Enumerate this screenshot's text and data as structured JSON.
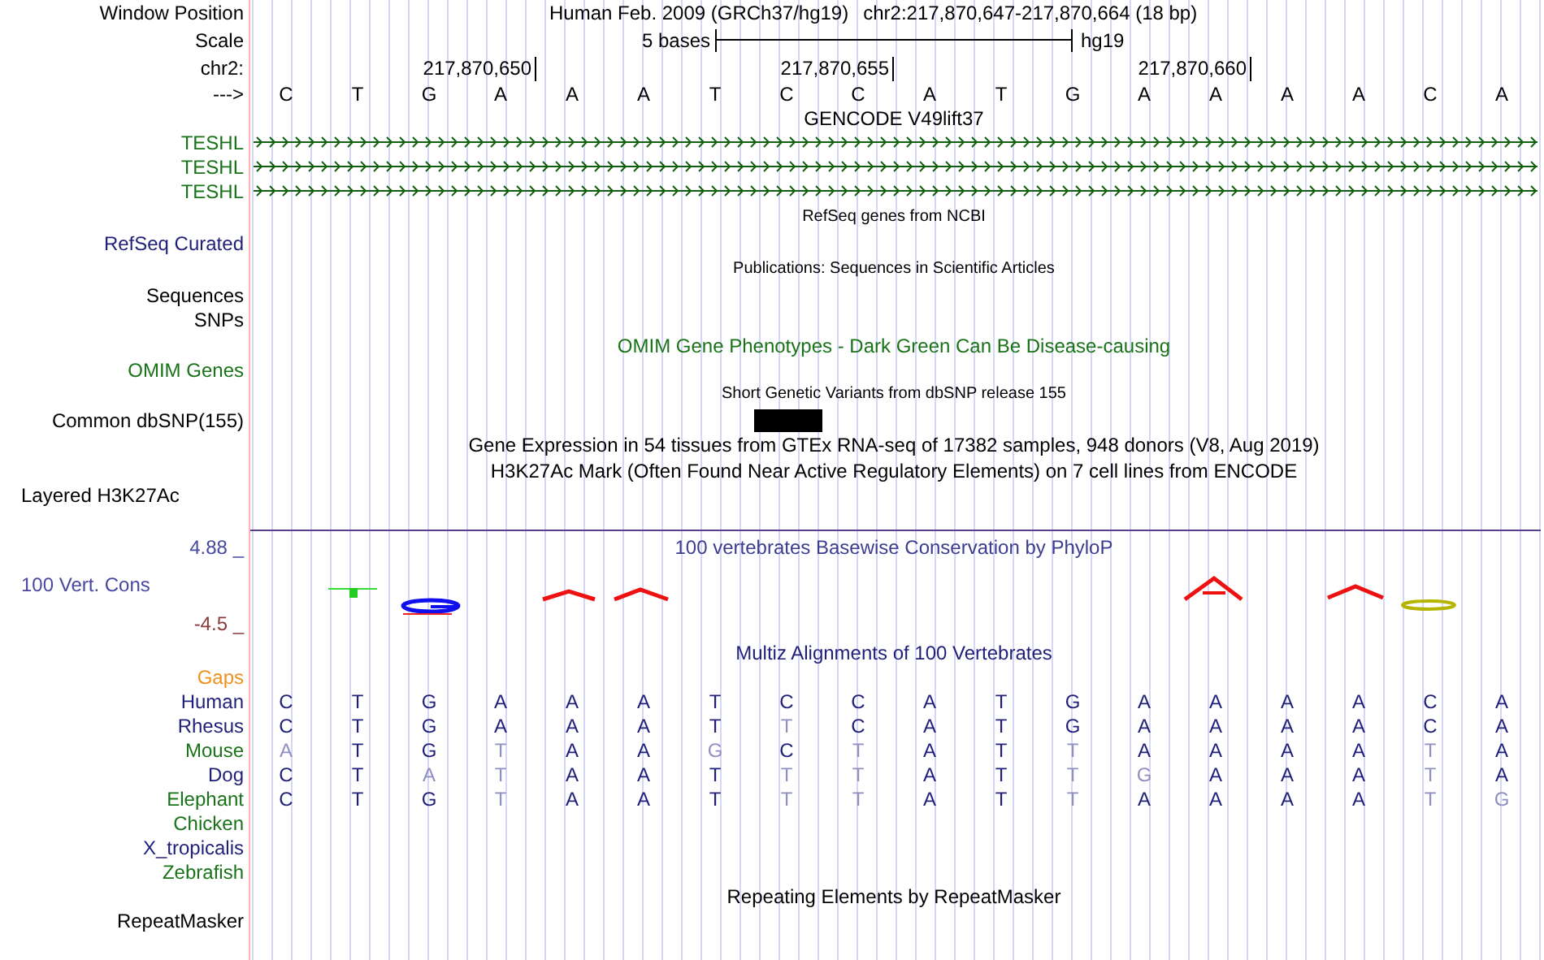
{
  "position": {
    "label": "Window Position",
    "assembly": "Human Feb. 2009 (GRCh37/hg19)",
    "range": "chr2:217,870,647-217,870,664 (18 bp)"
  },
  "scale": {
    "label": "Scale",
    "length": "5 bases",
    "assembly": "hg19"
  },
  "ruler": {
    "label": "chr2:",
    "ticks": [
      "217,870,650",
      "217,870,655",
      "217,870,660"
    ]
  },
  "bases": {
    "label": "--->",
    "letters": [
      "C",
      "T",
      "G",
      "A",
      "A",
      "A",
      "T",
      "C",
      "C",
      "A",
      "T",
      "G",
      "A",
      "A",
      "A",
      "A",
      "C",
      "A"
    ]
  },
  "tracks": [
    {
      "kind": "gene_track",
      "title": "GENCODE V49lift37",
      "rows": [
        {
          "label": "TESHL",
          "color": "#197319"
        },
        {
          "label": "TESHL",
          "color": "#197319"
        },
        {
          "label": "TESHL",
          "color": "#197319"
        }
      ]
    },
    {
      "kind": "annotation_track",
      "title": "RefSeq genes from NCBI",
      "rows": [
        {
          "label": "RefSeq Curated",
          "color": "#1f1f7a"
        }
      ]
    },
    {
      "kind": "annotation_track",
      "title": "Publications: Sequences in Scientific Articles",
      "rows": [
        {
          "label": "Sequences",
          "color": "#000000"
        },
        {
          "label": "SNPs",
          "color": "#000000"
        }
      ]
    },
    {
      "kind": "phenotype_track",
      "title": "OMIM Gene Phenotypes - Dark Green Can Be Disease-causing",
      "rows": [
        {
          "label": "OMIM Genes",
          "color": "#197319"
        }
      ]
    },
    {
      "kind": "variant_track",
      "title": "Short Genetic Variants from dbSNP release 155",
      "rows": [
        {
          "label": "Common dbSNP(155)",
          "color": "#000000"
        }
      ]
    },
    {
      "kind": "expression_track",
      "title": "Gene Expression in 54 tissues from GTEx RNA-seq of 17382 samples, 948 donors (V8, Aug 2019)"
    },
    {
      "kind": "signal_track",
      "title": "H3K27Ac Mark (Often Found Near Active Regulatory Elements) on 7 cell lines from ENCODE",
      "rows": [
        {
          "label": "Layered H3K27Ac",
          "color": "#000000"
        }
      ]
    },
    {
      "kind": "conservation_track",
      "title": "100 vertebrates Basewise Conservation by PhyloP",
      "label": "100 Vert. Cons",
      "axis_max": "4.88 _",
      "axis_min": "-4.5 _"
    },
    {
      "kind": "alignment_track",
      "title": "Multiz Alignments of 100 Vertebrates",
      "gaps": {
        "label": "Gaps",
        "color": "#f0901e"
      },
      "species": [
        {
          "label": "Human",
          "color": "#1f1f7a",
          "bases": [
            {
              "base": "C",
              "match": true
            },
            {
              "base": "T",
              "match": true
            },
            {
              "base": "G",
              "match": true
            },
            {
              "base": "A",
              "match": true
            },
            {
              "base": "A",
              "match": true
            },
            {
              "base": "A",
              "match": true
            },
            {
              "base": "T",
              "match": true
            },
            {
              "base": "C",
              "match": true
            },
            {
              "base": "C",
              "match": true
            },
            {
              "base": "A",
              "match": true
            },
            {
              "base": "T",
              "match": true
            },
            {
              "base": "G",
              "match": true
            },
            {
              "base": "A",
              "match": true
            },
            {
              "base": "A",
              "match": true
            },
            {
              "base": "A",
              "match": true
            },
            {
              "base": "A",
              "match": true
            },
            {
              "base": "C",
              "match": true
            },
            {
              "base": "A",
              "match": true
            }
          ]
        },
        {
          "label": "Rhesus",
          "color": "#1f1f7a",
          "bases": [
            {
              "base": "C",
              "match": true
            },
            {
              "base": "T",
              "match": true
            },
            {
              "base": "G",
              "match": true
            },
            {
              "base": "A",
              "match": true
            },
            {
              "base": "A",
              "match": true
            },
            {
              "base": "A",
              "match": true
            },
            {
              "base": "T",
              "match": true
            },
            {
              "base": "T",
              "match": false
            },
            {
              "base": "C",
              "match": true
            },
            {
              "base": "A",
              "match": true
            },
            {
              "base": "T",
              "match": true
            },
            {
              "base": "G",
              "match": true
            },
            {
              "base": "A",
              "match": true
            },
            {
              "base": "A",
              "match": true
            },
            {
              "base": "A",
              "match": true
            },
            {
              "base": "A",
              "match": true
            },
            {
              "base": "C",
              "match": true
            },
            {
              "base": "A",
              "match": true
            }
          ]
        },
        {
          "label": "Mouse",
          "color": "#197319",
          "bases": [
            {
              "base": "A",
              "match": false
            },
            {
              "base": "T",
              "match": true
            },
            {
              "base": "G",
              "match": true
            },
            {
              "base": "T",
              "match": false
            },
            {
              "base": "A",
              "match": true
            },
            {
              "base": "A",
              "match": true
            },
            {
              "base": "G",
              "match": false
            },
            {
              "base": "C",
              "match": true
            },
            {
              "base": "T",
              "match": false
            },
            {
              "base": "A",
              "match": true
            },
            {
              "base": "T",
              "match": true
            },
            {
              "base": "T",
              "match": false
            },
            {
              "base": "A",
              "match": true
            },
            {
              "base": "A",
              "match": true
            },
            {
              "base": "A",
              "match": true
            },
            {
              "base": "A",
              "match": true
            },
            {
              "base": "T",
              "match": false
            },
            {
              "base": "A",
              "match": true
            }
          ]
        },
        {
          "label": "Dog",
          "color": "#1f1f7a",
          "bases": [
            {
              "base": "C",
              "match": true
            },
            {
              "base": "T",
              "match": true
            },
            {
              "base": "A",
              "match": false
            },
            {
              "base": "T",
              "match": false
            },
            {
              "base": "A",
              "match": true
            },
            {
              "base": "A",
              "match": true
            },
            {
              "base": "T",
              "match": true
            },
            {
              "base": "T",
              "match": false
            },
            {
              "base": "T",
              "match": false
            },
            {
              "base": "A",
              "match": true
            },
            {
              "base": "T",
              "match": true
            },
            {
              "base": "T",
              "match": false
            },
            {
              "base": "G",
              "match": false
            },
            {
              "base": "A",
              "match": true
            },
            {
              "base": "A",
              "match": true
            },
            {
              "base": "A",
              "match": true
            },
            {
              "base": "T",
              "match": false
            },
            {
              "base": "A",
              "match": true
            }
          ]
        },
        {
          "label": "Elephant",
          "color": "#197319",
          "bases": [
            {
              "base": "C",
              "match": true
            },
            {
              "base": "T",
              "match": true
            },
            {
              "base": "G",
              "match": true
            },
            {
              "base": "T",
              "match": false
            },
            {
              "base": "A",
              "match": true
            },
            {
              "base": "A",
              "match": true
            },
            {
              "base": "T",
              "match": true
            },
            {
              "base": "T",
              "match": false
            },
            {
              "base": "T",
              "match": false
            },
            {
              "base": "A",
              "match": true
            },
            {
              "base": "T",
              "match": true
            },
            {
              "base": "T",
              "match": false
            },
            {
              "base": "A",
              "match": true
            },
            {
              "base": "A",
              "match": true
            },
            {
              "base": "A",
              "match": true
            },
            {
              "base": "A",
              "match": true
            },
            {
              "base": "T",
              "match": false
            },
            {
              "base": "G",
              "match": false
            }
          ]
        },
        {
          "label": "Chicken",
          "color": "#197319"
        },
        {
          "label": "X_tropicalis",
          "color": "#1f1f7a"
        },
        {
          "label": "Zebrafish",
          "color": "#197319"
        }
      ]
    },
    {
      "kind": "repeat_track",
      "title": "Repeating Elements by RepeatMasker",
      "rows": [
        {
          "label": "RepeatMasker",
          "color": "#000000"
        }
      ]
    }
  ]
}
